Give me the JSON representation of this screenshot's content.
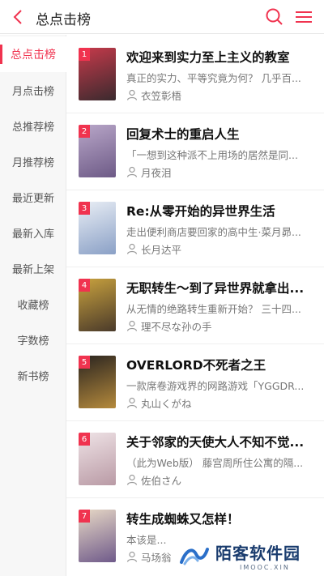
{
  "header": {
    "title": "总点击榜"
  },
  "sidebar": {
    "items": [
      {
        "label": "总点击榜",
        "active": true
      },
      {
        "label": "月点击榜"
      },
      {
        "label": "总推荐榜"
      },
      {
        "label": "月推荐榜"
      },
      {
        "label": "最近更新"
      },
      {
        "label": "最新入库"
      },
      {
        "label": "最新上架"
      },
      {
        "label": "收藏榜"
      },
      {
        "label": "字数榜"
      },
      {
        "label": "新书榜"
      }
    ]
  },
  "books": [
    {
      "rank": "1",
      "title": "欢迎来到实力至上主义的教室",
      "desc": "真正的实力、平等究竟为何？ 几乎百...",
      "author": "衣笠彰梧",
      "cover_colors": [
        "#c73a4b",
        "#3a2a2e"
      ]
    },
    {
      "rank": "2",
      "title": "回复术士的重启人生",
      "desc": "「一想到这种派不上用场的居然是同...",
      "author": "月夜泪",
      "cover_colors": [
        "#b9a7c9",
        "#6d5a86"
      ]
    },
    {
      "rank": "3",
      "title": "Re:从零开始的异世界生活",
      "desc": "走出便利商店要回家的高中生·菜月昴...",
      "author": "长月达平",
      "cover_colors": [
        "#e9eef5",
        "#8aa0c6"
      ]
    },
    {
      "rank": "4",
      "title": "无职转生～到了异世界就拿出...",
      "desc": "从无情的绝路转生重新开始？ 三十四...",
      "author": "理不尽な孙の手",
      "cover_colors": [
        "#c9a23e",
        "#4a3a2a"
      ]
    },
    {
      "rank": "5",
      "title": "OVERLORD不死者之王",
      "desc": "一款席卷游戏界的网路游戏「YGGDR...",
      "author": "丸山くがね",
      "cover_colors": [
        "#2a2420",
        "#b58a3c"
      ]
    },
    {
      "rank": "6",
      "title": "关于邻家的天使大人不知不觉...",
      "desc": "（此为Web版） 藤宫周所住公寓的隔...",
      "author": "佐伯さん",
      "cover_colors": [
        "#efe3e6",
        "#b99aa5"
      ]
    },
    {
      "rank": "7",
      "title": "转生成蜘蛛又怎样！",
      "desc": "本该是...",
      "author": "马场翁",
      "cover_colors": [
        "#e8d9c6",
        "#6f5a8a"
      ]
    }
  ],
  "watermark": {
    "name": "陌客软件园",
    "sub": "IMOOC.XIN"
  },
  "colors": {
    "accent": "#f0334f"
  }
}
